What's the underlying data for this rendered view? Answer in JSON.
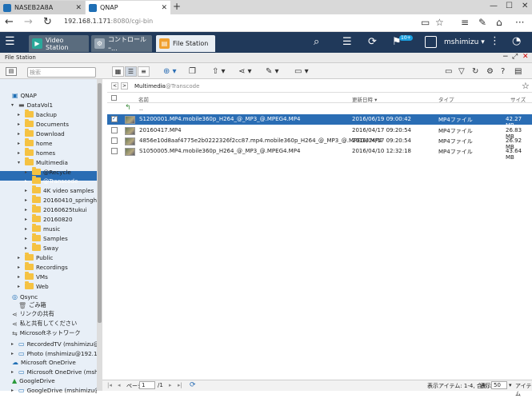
{
  "browser": {
    "tabs": [
      {
        "label": "NASEB2A8A"
      },
      {
        "label": "QNAP"
      }
    ],
    "url_host": "192.168.1.171",
    "url_rest": ":8080/cgi-bin"
  },
  "qts": {
    "apps": [
      {
        "label": "Video Station",
        "color": "#2aa89a"
      },
      {
        "label": "コントロールｰ...",
        "color": "#9aa8b5"
      },
      {
        "label": "File Station",
        "color": "#f0a030"
      }
    ],
    "badge": "10+",
    "user": "mshimizu"
  },
  "filestation": {
    "title": "File Station",
    "search_placeholder": "検索",
    "breadcrumb": [
      "Multimedia",
      "@Transcode"
    ],
    "columns": {
      "name": "名前",
      "date": "更新日時",
      "type": "タイプ",
      "size": "サイズ"
    },
    "parent_label": "..",
    "files": [
      {
        "name": "S1200001.MP4.mobile360p_H264_@_MP3_@.MPEG4.MP4",
        "date": "2016/06/19 09:00:42",
        "type": "MP4ファイル",
        "size": "42.27 MB",
        "selected": true
      },
      {
        "name": "20160417.MP4",
        "date": "2016/04/17 09:20:54",
        "type": "MP4ファイル",
        "size": "26.83 MB",
        "selected": false
      },
      {
        "name": "4856e10d8aaf4775e2b0222326f2cc87.mp4.mobile360p_H264_@_MP3_@.MPEG4.MP4",
        "date": "2016/04/17 09:20:54",
        "type": "MP4ファイル",
        "size": "26.92 MB",
        "selected": false
      },
      {
        "name": "S1050005.MP4.mobile360p_H264_@_MP3_@.MPEG4.MP4",
        "date": "2016/04/10 12:32:18",
        "type": "MP4ファイル",
        "size": "43.64 MB",
        "selected": false
      }
    ],
    "tree": [
      {
        "label": "QNAP",
        "level": 0,
        "kind": "nas"
      },
      {
        "label": "DataVol1",
        "level": 1,
        "kind": "vol"
      },
      {
        "label": "backup",
        "level": 2,
        "kind": "folder"
      },
      {
        "label": "Documents",
        "level": 2,
        "kind": "folder"
      },
      {
        "label": "Download",
        "level": 2,
        "kind": "folder"
      },
      {
        "label": "home",
        "level": 2,
        "kind": "folder"
      },
      {
        "label": "homes",
        "level": 2,
        "kind": "folder"
      },
      {
        "label": "Multimedia",
        "level": 2,
        "kind": "folder",
        "open": true
      },
      {
        "label": "@Recycle",
        "level": 3,
        "kind": "folder"
      },
      {
        "label": "@Transcode",
        "level": 3,
        "kind": "folder",
        "selected": true
      },
      {
        "label": "4K video samples",
        "level": 3,
        "kind": "folder"
      },
      {
        "label": "20160410_springhorseshow",
        "level": 3,
        "kind": "folder"
      },
      {
        "label": "20160625tukui",
        "level": 3,
        "kind": "folder"
      },
      {
        "label": "20160820",
        "level": 3,
        "kind": "folder"
      },
      {
        "label": "music",
        "level": 3,
        "kind": "folder"
      },
      {
        "label": "Samples",
        "level": 3,
        "kind": "folder"
      },
      {
        "label": "Sway",
        "level": 3,
        "kind": "folder"
      },
      {
        "label": "Public",
        "level": 2,
        "kind": "folder"
      },
      {
        "label": "Recordings",
        "level": 2,
        "kind": "folder"
      },
      {
        "label": "VMs",
        "level": 2,
        "kind": "folder"
      },
      {
        "label": "Web",
        "level": 2,
        "kind": "folder"
      },
      {
        "label": "Qsync",
        "level": 0,
        "kind": "qsync"
      },
      {
        "label": "ごみ箱",
        "level": 1,
        "kind": "trash"
      },
      {
        "label": "リンクの共有",
        "level": 0,
        "kind": "share"
      },
      {
        "label": "私と共有してください",
        "level": 0,
        "kind": "share"
      },
      {
        "label": "Microsoftネットワーク",
        "level": 0,
        "kind": "net"
      },
      {
        "label": "RecordedTV (mshimizu@192.1",
        "level": 1,
        "kind": "pc"
      },
      {
        "label": "Photo (mshimizu@192.168.1.1",
        "level": 1,
        "kind": "pc"
      },
      {
        "label": "Microsoft OneDrive",
        "level": 0,
        "kind": "cloud"
      },
      {
        "label": "Microsoft OneDrive (mshimizu",
        "level": 1,
        "kind": "pc"
      },
      {
        "label": "GoogleDrive",
        "level": 0,
        "kind": "gdrive"
      },
      {
        "label": "GoogleDrive (mshimizu@mshimi",
        "level": 1,
        "kind": "pc"
      }
    ],
    "status": {
      "page_label": "ページ",
      "page_value": "1",
      "page_total": "/1",
      "items_text": "表示アイテム: 1-4, 合計: 4",
      "show_label": "表示",
      "per_page": "50",
      "items_label": "アイテム"
    }
  }
}
